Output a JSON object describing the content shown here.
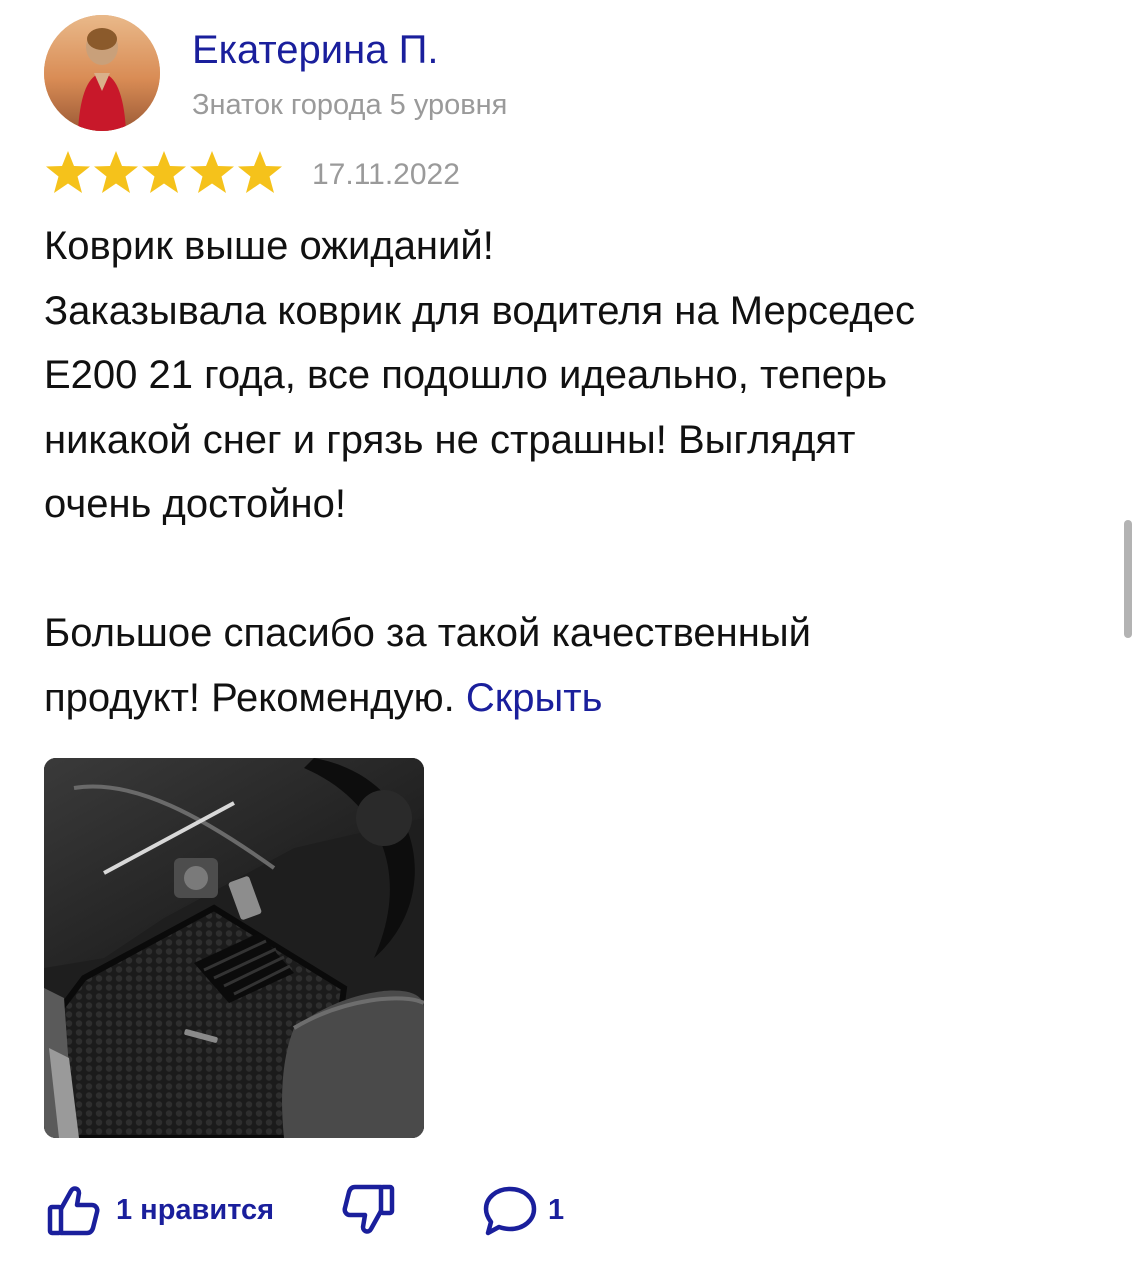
{
  "review": {
    "author": {
      "name": "Екатерина П.",
      "level": "Знаток города 5 уровня",
      "avatar_icon": "user-avatar-photo"
    },
    "rating": 5,
    "rating_max": 5,
    "star_color": "#f5c21b",
    "date": "17.11.2022",
    "text_lines": [
      "Коврик выше ожиданий!",
      "Заказывала коврик для водителя на Мерседес",
      "E200 21 года, все подошло идеально, теперь",
      "никакой снег и грязь не страшны! Выглядят",
      "очень достойно!"
    ],
    "text_closing": [
      "Большое спасибо за такой качественный",
      "продукт! Рекомендую."
    ],
    "hide_link": "Скрыть",
    "photo_icon": "car-floor-mat-photo",
    "actions": {
      "like_icon": "thumbs-up-icon",
      "like_label": "1 нравится",
      "dislike_icon": "thumbs-down-icon",
      "comment_icon": "comment-bubble-icon",
      "comment_count": "1"
    },
    "accent_color": "#1a1f9c"
  }
}
